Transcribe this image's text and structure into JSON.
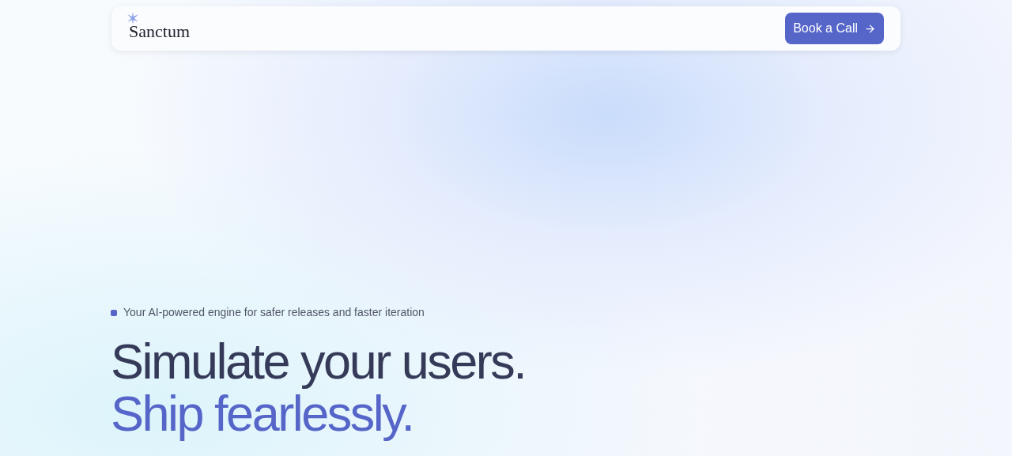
{
  "header": {
    "logo": "Sanctum",
    "cta": "Book a Call"
  },
  "hero": {
    "tagline": "Your AI-powered engine for safer releases and faster iteration",
    "headline": [
      "Simulate your users.",
      "Ship fearlessly."
    ]
  }
}
